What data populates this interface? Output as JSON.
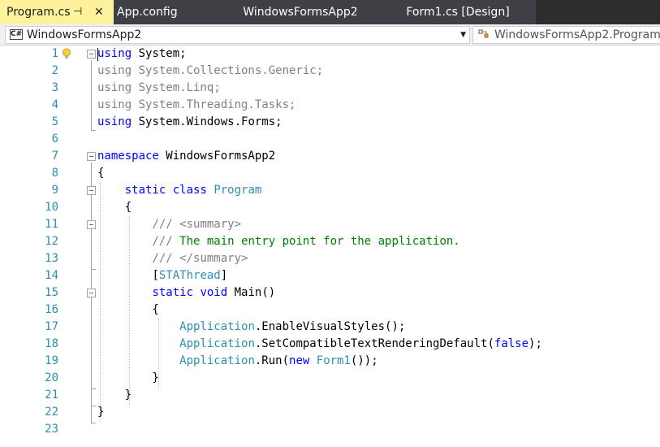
{
  "tabs": [
    {
      "label": "Program.cs",
      "active": true
    },
    {
      "label": "App.config",
      "active": false
    },
    {
      "label": "WindowsFormsApp2",
      "active": false
    },
    {
      "label": "Form1.cs [Design]",
      "active": false
    }
  ],
  "tab_icons": {
    "pin": "⊣",
    "close": "✕"
  },
  "navbar": {
    "project_combo": "WindowsFormsApp2",
    "project_icon_text": "C#",
    "member_combo": "WindowsFormsApp2.Program"
  },
  "line_numbers": [
    "1",
    "2",
    "3",
    "4",
    "5",
    "6",
    "7",
    "8",
    "9",
    "10",
    "11",
    "12",
    "13",
    "14",
    "15",
    "16",
    "17",
    "18",
    "19",
    "20",
    "21",
    "22",
    "23"
  ],
  "code": {
    "l1": {
      "kw": "using",
      "rest": " System;"
    },
    "l2": {
      "text": "using System.Collections.Generic;"
    },
    "l3": {
      "text": "using System.Linq;"
    },
    "l4": {
      "text": "using System.Threading.Tasks;"
    },
    "l5": {
      "kw": "using",
      "rest": " System.Windows.Forms;"
    },
    "l7": {
      "kw": "namespace",
      "rest": " WindowsFormsApp2"
    },
    "l8": {
      "text": "{"
    },
    "l9": {
      "indent": "    ",
      "kw1": "static",
      "sp": " ",
      "kw2": "class",
      "sp2": " ",
      "type": "Program"
    },
    "l10": {
      "text": "    {"
    },
    "l11": {
      "indent": "        ",
      "slashes": "///",
      "tag": " <summary>"
    },
    "l12": {
      "indent": "        ",
      "slashes": "///",
      "comment": " The main entry point for the application."
    },
    "l13": {
      "indent": "        ",
      "slashes": "///",
      "tag": " </summary>"
    },
    "l14": {
      "indent": "        ",
      "open": "[",
      "attr": "STAThread",
      "close": "]"
    },
    "l15": {
      "indent": "        ",
      "kw1": "static",
      "sp": " ",
      "kw2": "void",
      "rest": " Main()"
    },
    "l16": {
      "text": "        {"
    },
    "l17": {
      "indent": "            ",
      "type": "Application",
      "rest": ".EnableVisualStyles();"
    },
    "l18": {
      "indent": "            ",
      "type": "Application",
      "mid": ".SetCompatibleTextRenderingDefault(",
      "kw": "false",
      "end": ");"
    },
    "l19": {
      "indent": "            ",
      "type": "Application",
      "mid": ".Run(",
      "kw": "new",
      "sp": " ",
      "type2": "Form1",
      "end": "());"
    },
    "l20": {
      "text": "        }"
    },
    "l21": {
      "text": "    }"
    },
    "l22": {
      "text": "}"
    }
  },
  "colors": {
    "keyword": "#0000ff",
    "type": "#2b91af",
    "comment": "#008000",
    "xmldoc": "#808080",
    "active_tab": "#fff29d",
    "tabbar": "#2d2d30"
  }
}
